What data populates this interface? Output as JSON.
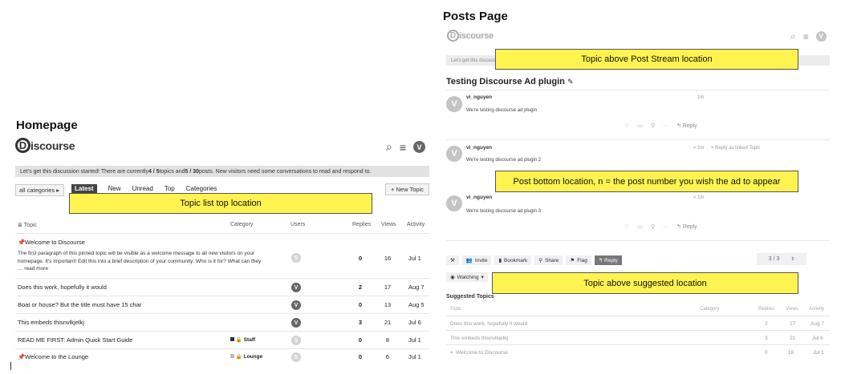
{
  "homepage": {
    "section_title": "Homepage",
    "logo": {
      "mark": "D",
      "text": "iscourse"
    },
    "header_icons": {
      "search": "⌕",
      "menu": "≡",
      "avatar": "V"
    },
    "banner": {
      "prefix": "Let's get this discussion started! There are currently ",
      "topics": "4 / 5",
      "mid1": " topics and ",
      "posts": "5 / 30",
      "mid2": " posts. New visitors need some conversations to read and respond to."
    },
    "category_dropdown": "all categories ▸",
    "nav": [
      "Latest",
      "New",
      "Unread",
      "Top",
      "Categories"
    ],
    "new_topic_label": "+ New Topic",
    "ad_label": "Topic list top location",
    "columns": {
      "topic": "≣  Topic",
      "category": "Category",
      "users": "Users",
      "replies": "Replies",
      "views": "Views",
      "activity": "Activity"
    },
    "topics": [
      {
        "title": "Welcome to Discourse",
        "pinned": true,
        "excerpt_1": "The first paragraph of this pinned topic will be visible as a welcome message to all new visitors on your",
        "excerpt_2": "homepage. It's important! Edit this into a brief description of your community: Who is it for? What can they",
        "excerpt_3": "… read more",
        "category": "",
        "user": "S",
        "replies": "0",
        "views": "16",
        "activity": "Jul 1"
      },
      {
        "title": "Does this work, hopefully it would",
        "category": "",
        "user": "V",
        "replies": "2",
        "views": "17",
        "activity": "Aug 7"
      },
      {
        "title": "Boat or house? But the title must have 15 char",
        "category": "",
        "user": "V",
        "replies": "0",
        "views": "13",
        "activity": "Aug 5"
      },
      {
        "title": "This embeds thisnvlkjelkj",
        "category": "",
        "user": "V",
        "replies": "3",
        "views": "21",
        "activity": "Jul 6"
      },
      {
        "title": "READ ME FIRST: Admin Quick Start Guide",
        "category": "Staff",
        "user": "S",
        "replies": "0",
        "views": "8",
        "activity": "Jul 1"
      },
      {
        "title": "Welcome to the Lounge",
        "pinned": true,
        "category": "Lounge",
        "user": "S",
        "replies": "0",
        "views": "6",
        "activity": "Jul 1"
      }
    ]
  },
  "posts_page": {
    "section_title": "Posts Page",
    "logo": {
      "mark": "D",
      "text": "iscourse"
    },
    "header_icons": {
      "search": "⌕",
      "menu": "≡",
      "avatar": "V"
    },
    "banner_text": "Let's get this discussio",
    "ad_top": "Topic above Post Stream location",
    "topic_title": "Testing Discourse Ad plugin",
    "edit_icon": "✎",
    "posts": [
      {
        "user": "vi_nguyen",
        "avatar": "V",
        "meta": "1m",
        "body": "We're testing discourse ad plugin",
        "reply": "↰ Reply"
      },
      {
        "user": "vi_nguyen",
        "avatar": "V",
        "meta": "< 1m",
        "linked": "+ Reply as linked Topic",
        "body": "We're testing discourse ad plugin 2",
        "reply": ""
      },
      {
        "user": "vi_nguyen",
        "avatar": "V",
        "meta": "< 1m",
        "body": "We're testing discourse ad plugin 3",
        "reply": "↰ Reply"
      }
    ],
    "ad_post_bottom": "Post bottom location, n = the post number you wish the ad to appear",
    "footer_buttons": {
      "wrench": "🔧",
      "invite": "Invite",
      "bookmark": "Bookmark",
      "share": "Share",
      "flag": "Flag",
      "reply": "↰ Reply"
    },
    "progress": "3 / 3",
    "watching": "Watching",
    "ad_suggested": "Topic above suggested location",
    "suggested": {
      "heading": "Suggested Topics",
      "columns": {
        "topic": "Topic",
        "category": "Category",
        "replies": "Replies",
        "views": "Views",
        "activity": "Activity"
      },
      "rows": [
        {
          "title": "Does this work, hopefully it would",
          "replies": "2",
          "views": "17",
          "activity": "Aug 7"
        },
        {
          "title": "This embeds thisnvlkjelkj",
          "replies": "3",
          "views": "21",
          "activity": "Jul 6"
        },
        {
          "title": "Welcome to Discourse",
          "pinned": true,
          "replies": "0",
          "views": "16",
          "activity": "Jul 1"
        }
      ]
    }
  },
  "colors": {
    "ad_yellow": "#fff44f",
    "banner_gray": "#e2e2e2",
    "avatar_dark": "#666666"
  }
}
